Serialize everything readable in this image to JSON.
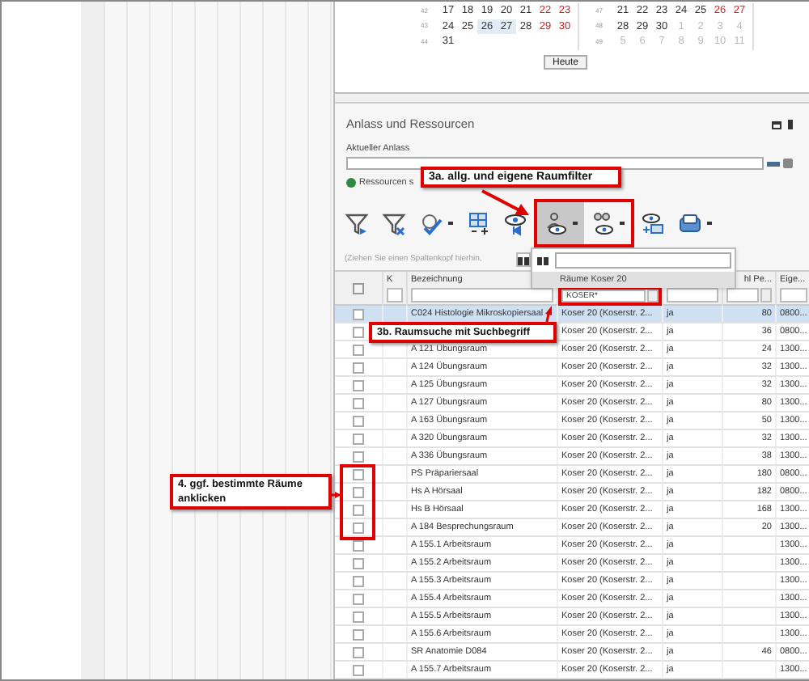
{
  "calendar": {
    "months": [
      {
        "weeks": [
          {
            "number": "42",
            "days": [
              {
                "text": "17",
                "kind": "weekday",
                "selected": false
              },
              {
                "text": "18",
                "kind": "weekday",
                "selected": false
              },
              {
                "text": "19",
                "kind": "weekday",
                "selected": false
              },
              {
                "text": "20",
                "kind": "weekday",
                "selected": false
              },
              {
                "text": "21",
                "kind": "weekday",
                "selected": false
              },
              {
                "text": "22",
                "kind": "weekend",
                "selected": false
              },
              {
                "text": "23",
                "kind": "weekend",
                "selected": false
              }
            ]
          },
          {
            "number": "43",
            "days": [
              {
                "text": "24",
                "kind": "weekday",
                "selected": false
              },
              {
                "text": "25",
                "kind": "weekday",
                "selected": false
              },
              {
                "text": "26",
                "kind": "weekday",
                "selected": true
              },
              {
                "text": "27",
                "kind": "weekday",
                "selected": true
              },
              {
                "text": "28",
                "kind": "weekday",
                "selected": false
              },
              {
                "text": "29",
                "kind": "weekend",
                "selected": false
              },
              {
                "text": "30",
                "kind": "weekend",
                "selected": false
              }
            ]
          },
          {
            "number": "44",
            "days": [
              {
                "text": "31",
                "kind": "weekday",
                "selected": false
              }
            ]
          }
        ]
      },
      {
        "weeks": [
          {
            "number": "47",
            "days": [
              {
                "text": "21",
                "kind": "weekday",
                "selected": false
              },
              {
                "text": "22",
                "kind": "weekday",
                "selected": false
              },
              {
                "text": "23",
                "kind": "weekday",
                "selected": false
              },
              {
                "text": "24",
                "kind": "weekday",
                "selected": false
              },
              {
                "text": "25",
                "kind": "weekday",
                "selected": false
              },
              {
                "text": "26",
                "kind": "weekend",
                "selected": false
              },
              {
                "text": "27",
                "kind": "weekend",
                "selected": false
              }
            ]
          },
          {
            "number": "48",
            "days": [
              {
                "text": "28",
                "kind": "weekday",
                "selected": false
              },
              {
                "text": "29",
                "kind": "weekday",
                "selected": false
              },
              {
                "text": "30",
                "kind": "weekday",
                "selected": false
              },
              {
                "text": "1",
                "kind": "other_month",
                "selected": false
              },
              {
                "text": "2",
                "kind": "other_month",
                "selected": false
              },
              {
                "text": "3",
                "kind": "other_month",
                "selected": false
              },
              {
                "text": "4",
                "kind": "other_month",
                "selected": false
              }
            ]
          },
          {
            "number": "49",
            "days": [
              {
                "text": "5",
                "kind": "other_month",
                "selected": false
              },
              {
                "text": "6",
                "kind": "other_month",
                "selected": false
              },
              {
                "text": "7",
                "kind": "other_month",
                "selected": false
              },
              {
                "text": "8",
                "kind": "other_month",
                "selected": false
              },
              {
                "text": "9",
                "kind": "other_month",
                "selected": false
              },
              {
                "text": "10",
                "kind": "other_month",
                "selected": false
              },
              {
                "text": "11",
                "kind": "other_month",
                "selected": false
              }
            ]
          }
        ]
      }
    ],
    "today_button": "Heute"
  },
  "panel": {
    "title": "Anlass und Ressourcen",
    "current_event_label": "Aktueller Anlass",
    "resources_label": "Ressourcen s"
  },
  "toolbar": [
    {
      "selected": false,
      "has_menu": false
    },
    {
      "selected": false,
      "has_menu": false
    },
    {
      "selected": false,
      "has_menu": true
    },
    {
      "selected": false,
      "has_menu": false
    },
    {
      "selected": false,
      "has_menu": false
    },
    {
      "selected": true,
      "has_menu": true
    },
    {
      "selected": false,
      "has_menu": true
    },
    {
      "selected": false,
      "has_menu": false
    },
    {
      "selected": false,
      "has_menu": true
    }
  ],
  "group_hint": "(Ziehen Sie einen Spaltenkopf hierhin,",
  "filter_popup": {
    "items": [
      {
        "label": "Räume Koser 20",
        "selected": true
      }
    ]
  },
  "table": {
    "select_all_checked": false,
    "headers": {
      "k": "K",
      "name": "Bezeichnung",
      "column_6": "hl Pe...",
      "column_7": "Eige..."
    },
    "filters": {
      "column_4": "KOSER*"
    },
    "rows": [
      {
        "selected": true,
        "checked": false,
        "name": "C024 Histologie Mikroskopiersaal",
        "location": "Koser 20 (Koserstr. 2...",
        "column_5": "ja",
        "persons": "80",
        "column_7": "0800..."
      },
      {
        "selected": false,
        "checked": false,
        "location": "Koser 20 (Koserstr. 2...",
        "column_5": "ja",
        "persons": "36",
        "column_7": "0800..."
      },
      {
        "selected": false,
        "checked": false,
        "name": "A 121 Übungsraum",
        "location": "Koser 20 (Koserstr. 2...",
        "column_5": "ja",
        "persons": "24",
        "column_7": "1300..."
      },
      {
        "selected": false,
        "checked": false,
        "name": "A 124 Übungsraum",
        "location": "Koser 20 (Koserstr. 2...",
        "column_5": "ja",
        "persons": "32",
        "column_7": "1300..."
      },
      {
        "selected": false,
        "checked": false,
        "name": "A 125 Übungsraum",
        "location": "Koser 20 (Koserstr. 2...",
        "column_5": "ja",
        "persons": "32",
        "column_7": "1300..."
      },
      {
        "selected": false,
        "checked": false,
        "name": "A 127 Übungsraum",
        "location": "Koser 20 (Koserstr. 2...",
        "column_5": "ja",
        "persons": "80",
        "column_7": "1300..."
      },
      {
        "selected": false,
        "checked": false,
        "name": "A 163 Übungsraum",
        "location": "Koser 20 (Koserstr. 2...",
        "column_5": "ja",
        "persons": "50",
        "column_7": "1300..."
      },
      {
        "selected": false,
        "checked": false,
        "name": "A 320 Übungsraum",
        "location": "Koser 20 (Koserstr. 2...",
        "column_5": "ja",
        "persons": "32",
        "column_7": "1300..."
      },
      {
        "selected": false,
        "checked": false,
        "name": "A 336 Übungsraum",
        "location": "Koser 20 (Koserstr. 2...",
        "column_5": "ja",
        "persons": "38",
        "column_7": "1300..."
      },
      {
        "selected": false,
        "checked": false,
        "name": "PS Präpariersaal",
        "location": "Koser 20 (Koserstr. 2...",
        "column_5": "ja",
        "persons": "180",
        "column_7": "0800..."
      },
      {
        "selected": false,
        "checked": false,
        "name": "Hs A Hörsaal",
        "location": "Koser 20 (Koserstr. 2...",
        "column_5": "ja",
        "persons": "182",
        "column_7": "0800..."
      },
      {
        "selected": false,
        "checked": false,
        "name": "Hs B Hörsaal",
        "location": "Koser 20 (Koserstr. 2...",
        "column_5": "ja",
        "persons": "168",
        "column_7": "1300..."
      },
      {
        "selected": false,
        "checked": false,
        "name": "A 184 Besprechungsraum",
        "location": "Koser 20 (Koserstr. 2...",
        "column_5": "ja",
        "persons": "20",
        "column_7": "1300..."
      },
      {
        "selected": false,
        "checked": false,
        "name": "A 155.1 Arbeitsraum",
        "location": "Koser 20 (Koserstr. 2...",
        "column_5": "ja",
        "column_7": "1300..."
      },
      {
        "selected": false,
        "checked": false,
        "name": "A 155.2 Arbeitsraum",
        "location": "Koser 20 (Koserstr. 2...",
        "column_5": "ja",
        "column_7": "1300..."
      },
      {
        "selected": false,
        "checked": false,
        "name": "A 155.3 Arbeitsraum",
        "location": "Koser 20 (Koserstr. 2...",
        "column_5": "ja",
        "column_7": "1300..."
      },
      {
        "selected": false,
        "checked": false,
        "name": "A 155.4 Arbeitsraum",
        "location": "Koser 20 (Koserstr. 2...",
        "column_5": "ja",
        "column_7": "1300..."
      },
      {
        "selected": false,
        "checked": false,
        "name": "A 155.5 Arbeitsraum",
        "location": "Koser 20 (Koserstr. 2...",
        "column_5": "ja",
        "column_7": "1300..."
      },
      {
        "selected": false,
        "checked": false,
        "name": "A 155.6 Arbeitsraum",
        "location": "Koser 20 (Koserstr. 2...",
        "column_5": "ja",
        "column_7": "1300..."
      },
      {
        "selected": false,
        "checked": false,
        "name": "SR Anatomie D084",
        "location": "Koser 20 (Koserstr. 2...",
        "column_5": "ja",
        "persons": "46",
        "column_7": "0800..."
      },
      {
        "selected": false,
        "checked": false,
        "name": "A 155.7 Arbeitsraum",
        "location": "Koser 20 (Koserstr. 2...",
        "column_5": "ja",
        "column_7": "1300..."
      }
    ]
  },
  "callouts": [
    {
      "text": "3a. allg. und eigene Raumfilter"
    },
    {
      "text": "3b. Raumsuche mit Suchbegriff"
    },
    {
      "text": "4. ggf. bestimmte Räume anklicken"
    }
  ]
}
